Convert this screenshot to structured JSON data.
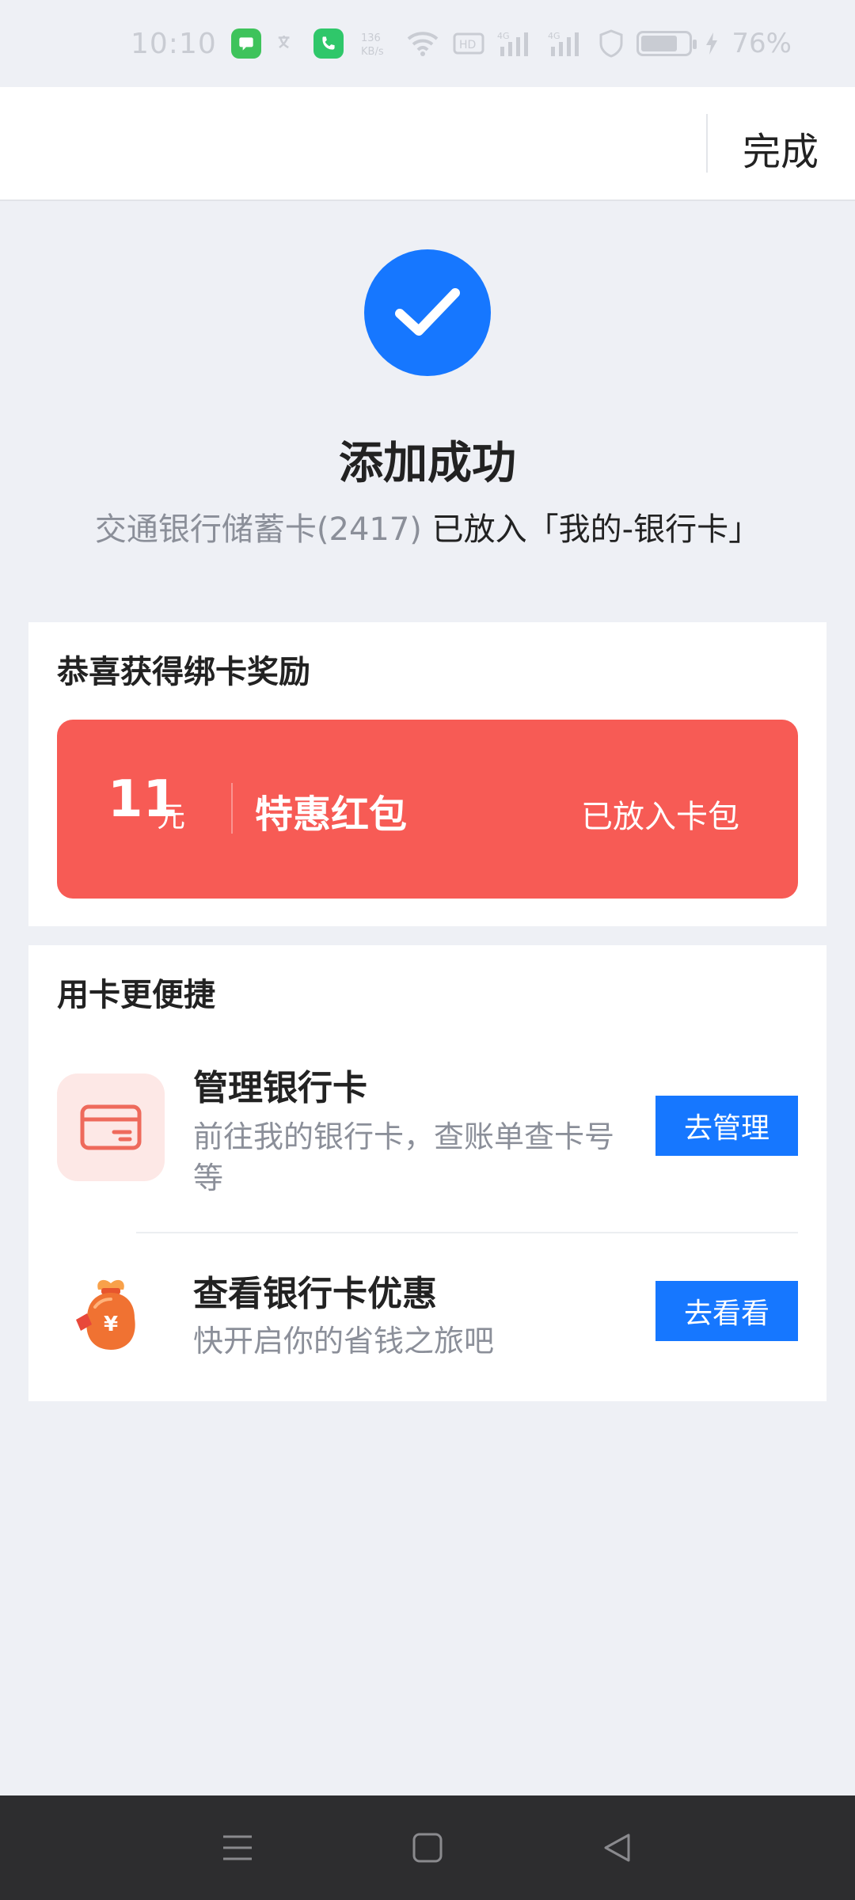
{
  "status_bar": {
    "time": "10:10",
    "battery": "76%"
  },
  "header": {
    "done_label": "完成"
  },
  "success": {
    "title": "添加成功",
    "card_name": "交通银行储蓄卡(2417)",
    "placed_text": " 已放入「我的-银行卡」"
  },
  "reward": {
    "title": "恭喜获得绑卡奖励",
    "amount": "11",
    "unit": "元",
    "name": "特惠红包",
    "status": "已放入卡包"
  },
  "quick": {
    "title": "用卡更便捷",
    "items": [
      {
        "icon": "bank-card-icon",
        "name": "管理银行卡",
        "desc": "前往我的银行卡，查账单查卡号等",
        "button": "去管理"
      },
      {
        "icon": "money-bag-icon",
        "name": "查看银行卡优惠",
        "desc": "快开启你的省钱之旅吧",
        "button": "去看看"
      }
    ]
  },
  "colors": {
    "primary": "#1677ff",
    "red_packet": "#f75b55",
    "background": "#eef0f5"
  }
}
